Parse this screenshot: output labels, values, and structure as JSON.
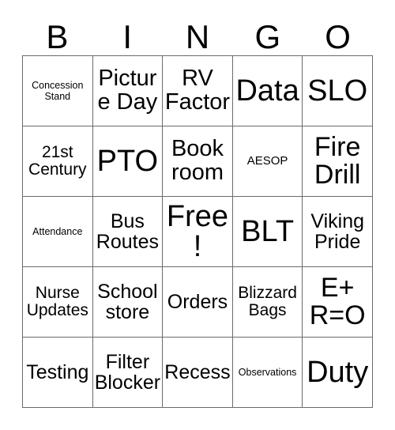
{
  "card": {
    "title": "BINGO Card",
    "header": {
      "letters": [
        "B",
        "I",
        "N",
        "G",
        "O"
      ]
    },
    "free_space_index": 12,
    "cells": [
      {
        "text": "Concession Stand",
        "size": "xs"
      },
      {
        "text": "Picture Day",
        "size": "xl"
      },
      {
        "text": "RV Factor",
        "size": "xl"
      },
      {
        "text": "Data",
        "size": "xxxl"
      },
      {
        "text": "SLO",
        "size": "xxxl"
      },
      {
        "text": "21st Century",
        "size": "m"
      },
      {
        "text": "PTO",
        "size": "xxxl"
      },
      {
        "text": "Book room",
        "size": "xl"
      },
      {
        "text": "AESOP",
        "size": "s"
      },
      {
        "text": "Fire Drill",
        "size": "xxl"
      },
      {
        "text": "Attendance",
        "size": "xs"
      },
      {
        "text": "Bus Routes",
        "size": "l"
      },
      {
        "text": "Free!",
        "size": "xxxl"
      },
      {
        "text": "BLT",
        "size": "xxxl"
      },
      {
        "text": "Viking Pride",
        "size": "l"
      },
      {
        "text": "Nurse Updates",
        "size": "m"
      },
      {
        "text": "School store",
        "size": "l"
      },
      {
        "text": "Orders",
        "size": "l"
      },
      {
        "text": "Blizzard Bags",
        "size": "m"
      },
      {
        "text": "E+ R=O",
        "size": "xxl"
      },
      {
        "text": "Testing",
        "size": "l"
      },
      {
        "text": "Filter Blocker",
        "size": "l"
      },
      {
        "text": "Recess",
        "size": "l"
      },
      {
        "text": "Observations",
        "size": "xs"
      },
      {
        "text": "Duty",
        "size": "xxxl"
      }
    ]
  },
  "colors": {
    "border": "#6b6b6b",
    "text": "#000000",
    "background": "#ffffff"
  }
}
